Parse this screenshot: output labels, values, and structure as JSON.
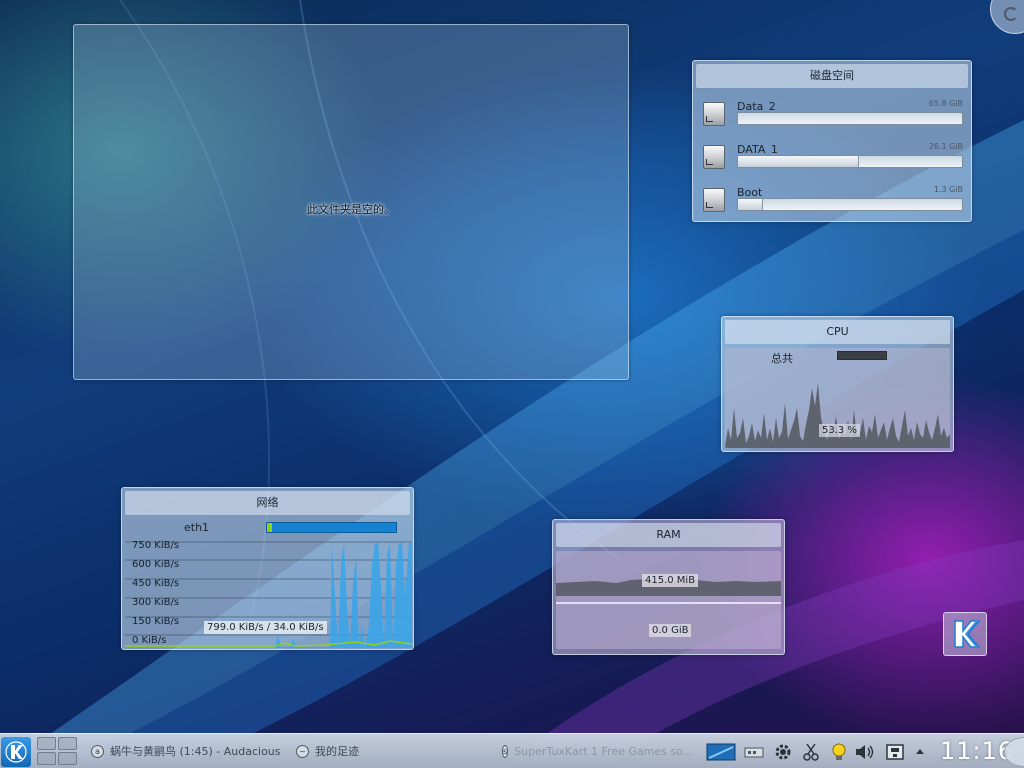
{
  "folder_view": {
    "empty_message": "此文件夹是空的。"
  },
  "disk_space": {
    "title": "磁盘空间",
    "disks": [
      {
        "name": "Data_2",
        "size": "65.8 GiB",
        "used_fraction": 0.0
      },
      {
        "name": "DATA_1",
        "size": "26.1 GiB",
        "used_fraction": 0.54
      },
      {
        "name": "Boot",
        "size": "1.3 GiB",
        "used_fraction": 0.11
      }
    ]
  },
  "cpu": {
    "title": "CPU",
    "total_label": "总共",
    "value": "53.3 %"
  },
  "network": {
    "title": "网络",
    "interface": "eth1",
    "axis_labels": [
      "750 KiB/s",
      "600 KiB/s",
      "450 KiB/s",
      "300 KiB/s",
      "150 KiB/s",
      "0 KiB/s"
    ],
    "value": "799.0 KiB/s / 34.0 KiB/s"
  },
  "ram": {
    "title": "RAM",
    "ram_value": "415.0 MiB",
    "swap_value": "0.0 GiB"
  },
  "taskbar": {
    "tasks": [
      {
        "label": "蜗牛与黄鹂鸟 (1:45) - Audacious",
        "icon": "audacious-icon"
      },
      {
        "label": "我的足迹",
        "icon": "dolphin-icon"
      },
      {
        "label": "SuperTuxKart 1 Free Games so...",
        "icon": "supertuxkart-icon"
      }
    ],
    "clock": "11:16"
  },
  "colors": {
    "network_fill": "#3ba4e8",
    "network_upload": "#8fd21e",
    "cpu_graph": "#5a5e66",
    "kde_blue": "#1d7fd6"
  }
}
